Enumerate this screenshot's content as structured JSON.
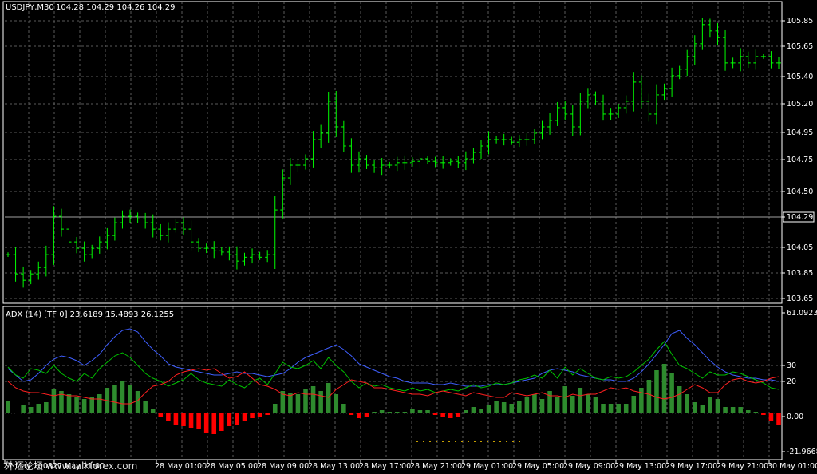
{
  "window": {
    "symbol_label": "USDJPY,M30",
    "ohlc_label": "104.28 104.29 104.26 104.29"
  },
  "colors": {
    "background": "#000000",
    "grid": "#5a5a5a",
    "bar": "#00ff00",
    "frame": "#ffffff",
    "adx_line": "#3f5fff",
    "plus_di": "#00c000",
    "minus_di": "#ff2020",
    "hist_up": "#2e8b2e",
    "hist_down": "#ff0000",
    "price_marker_bg": "#000000"
  },
  "watermark": "外汇论坛 www.talkforex.com",
  "chart_data": [
    {
      "type": "ohlc",
      "title": "USDJPY,M30",
      "y_ticks": [
        "105.85",
        "105.65",
        "105.40",
        "105.20",
        "104.95",
        "104.75",
        "104.50",
        "104.29",
        "104.05",
        "103.85",
        "103.65"
      ],
      "current_price": "104.29",
      "ylim": [
        103.62,
        105.98
      ],
      "x_tick_labels": [
        "27 May 2008",
        "27 May 21:00",
        "28 May 01:00",
        "28 May 05:00",
        "28 May 09:00",
        "28 May 13:00",
        "28 May 17:00",
        "28 May 21:00",
        "29 May 01:00",
        "29 May 05:00",
        "29 May 09:00",
        "29 May 13:00",
        "29 May 17:00",
        "29 May 21:00",
        "30 May 01:00"
      ],
      "close": [
        104.0,
        103.85,
        103.8,
        103.85,
        103.9,
        104.0,
        104.3,
        104.2,
        104.1,
        104.05,
        104.0,
        104.05,
        104.1,
        104.15,
        104.25,
        104.3,
        104.3,
        104.28,
        104.25,
        104.2,
        104.15,
        104.2,
        104.25,
        104.2,
        104.1,
        104.05,
        104.05,
        104.03,
        104.02,
        104.0,
        103.95,
        103.98,
        104.0,
        103.98,
        104.0,
        104.35,
        104.6,
        104.7,
        104.7,
        104.75,
        104.9,
        104.95,
        105.2,
        105.0,
        104.85,
        104.7,
        104.75,
        104.7,
        104.68,
        104.7,
        104.7,
        104.72,
        104.72,
        104.73,
        104.75,
        104.73,
        104.72,
        104.72,
        104.73,
        104.72,
        104.75,
        104.8,
        104.85,
        104.9,
        104.9,
        104.9,
        104.88,
        104.9,
        104.9,
        104.95,
        105.0,
        105.05,
        105.15,
        105.1,
        105.0,
        105.2,
        105.25,
        105.2,
        105.1,
        105.1,
        105.15,
        105.2,
        105.35,
        105.2,
        105.1,
        105.25,
        105.3,
        105.4,
        105.45,
        105.55,
        105.65,
        105.8,
        105.75,
        105.7,
        105.5,
        105.5,
        105.55,
        105.5,
        105.55,
        105.55,
        105.5,
        105.5
      ],
      "series": [
        {
          "name": "ADX (14) [TF 0]",
          "value": "23.6189"
        },
        {
          "name": "+DI",
          "value": "15.4893"
        },
        {
          "name": "-DI",
          "value": "26.1255"
        }
      ]
    },
    {
      "type": "line",
      "title": "ADX (14) [TF 0] 23.6189 15.4893 26.1255",
      "y_ticks": [
        "61.0923",
        "30",
        "20",
        "0.00",
        "-21.9668"
      ],
      "ylim": [
        -21.9668,
        61.0923
      ],
      "adx": [
        28,
        24,
        20,
        21,
        25,
        30,
        34,
        36,
        35,
        33,
        30,
        33,
        37,
        43,
        48,
        52,
        53,
        51,
        45,
        40,
        36,
        31,
        29,
        28,
        27,
        26,
        25,
        24,
        24,
        25,
        26,
        25,
        25,
        24,
        23,
        24,
        25,
        28,
        32,
        35,
        37,
        39,
        41,
        43,
        40,
        36,
        31,
        29,
        27,
        25,
        23,
        22,
        20,
        19,
        19,
        19,
        18,
        18,
        19,
        18,
        17,
        17,
        17,
        18,
        18,
        18,
        19,
        20,
        21,
        22,
        25,
        27,
        28,
        27,
        26,
        24,
        23,
        22,
        21,
        21,
        20,
        20,
        22,
        26,
        31,
        37,
        43,
        50,
        52,
        47,
        43,
        38,
        33,
        29,
        26,
        24,
        23,
        22,
        22,
        21,
        21,
        20
      ],
      "plus_di": [
        29,
        24,
        22,
        28,
        27,
        25,
        30,
        25,
        22,
        20,
        25,
        22,
        28,
        32,
        36,
        38,
        35,
        30,
        25,
        22,
        20,
        17,
        19,
        21,
        25,
        21,
        19,
        18,
        17,
        21,
        18,
        16,
        20,
        22,
        18,
        25,
        32,
        29,
        28,
        30,
        33,
        28,
        35,
        30,
        26,
        20,
        16,
        19,
        17,
        18,
        16,
        15,
        14,
        16,
        14,
        15,
        13,
        14,
        15,
        14,
        16,
        18,
        16,
        17,
        19,
        18,
        19,
        21,
        22,
        24,
        22,
        27,
        22,
        29,
        24,
        28,
        25,
        22,
        21,
        23,
        22,
        23,
        26,
        30,
        34,
        40,
        45,
        37,
        30,
        28,
        25,
        22,
        26,
        24,
        24,
        26,
        25,
        23,
        21,
        19,
        16,
        15
      ],
      "minus_di": [
        20,
        16,
        14,
        13,
        13,
        12,
        11,
        12,
        11,
        11,
        10,
        9,
        9,
        8,
        7,
        6,
        6,
        8,
        13,
        17,
        18,
        20,
        24,
        26,
        27,
        28,
        27,
        28,
        25,
        22,
        23,
        26,
        22,
        18,
        17,
        15,
        12,
        11,
        13,
        12,
        12,
        11,
        10,
        15,
        18,
        21,
        20,
        19,
        16,
        16,
        15,
        14,
        13,
        12,
        12,
        11,
        13,
        14,
        13,
        12,
        11,
        13,
        12,
        11,
        10,
        10,
        13,
        12,
        11,
        12,
        13,
        11,
        11,
        10,
        12,
        11,
        12,
        12,
        14,
        16,
        15,
        16,
        14,
        13,
        12,
        10,
        9,
        10,
        12,
        15,
        18,
        16,
        13,
        13,
        18,
        21,
        22,
        20,
        19,
        20,
        22,
        23
      ],
      "hist": [
        8,
        0,
        5,
        4,
        6,
        7,
        15,
        14,
        12,
        10,
        9,
        10,
        12,
        16,
        18,
        20,
        18,
        14,
        8,
        3,
        -2,
        -5,
        -7,
        -8,
        -9,
        -10,
        -12,
        -13,
        -11,
        -8,
        -7,
        -5,
        -3,
        -2,
        -1,
        6,
        14,
        13,
        12,
        15,
        17,
        14,
        19,
        12,
        6,
        -1,
        -3,
        -2,
        1,
        2,
        1,
        1,
        1,
        3,
        2,
        2,
        -1,
        -2,
        -3,
        -2,
        2,
        4,
        3,
        5,
        8,
        7,
        6,
        8,
        10,
        12,
        9,
        14,
        10,
        17,
        11,
        16,
        12,
        10,
        6,
        6,
        6,
        6,
        11,
        16,
        21,
        27,
        31,
        25,
        17,
        12,
        7,
        5,
        10,
        9,
        4,
        4,
        4,
        2,
        1,
        -1,
        -5,
        -7
      ]
    }
  ]
}
